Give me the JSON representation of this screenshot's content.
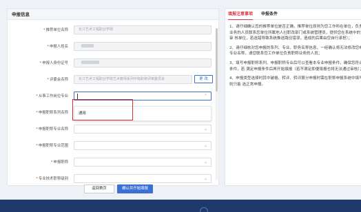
{
  "left_panel": {
    "title": "申报信息"
  },
  "form": {
    "recommender_unit": {
      "label": "推荐单位名称",
      "value": "长江艺术工程职业学院"
    },
    "applicant_name": {
      "label": "申报人姓名"
    },
    "applicant_id": {
      "label": "申报人身份证号"
    },
    "review_committee": {
      "label": "评委会名称",
      "value": "长江艺术工程职业学院艺术教师系列中级职称评审委员会",
      "change_label": "更 改"
    },
    "work_post": {
      "label": "从事工作岗位专业"
    },
    "title_series": {
      "label": "申报职称系列名称"
    },
    "title_specialty": {
      "label": "申报职称专业名称"
    },
    "title_scope": {
      "label": "申报职称专业范围"
    },
    "title_level": {
      "label": "申报职称"
    },
    "prof_title": {
      "label": "专业技术职称级别"
    }
  },
  "dropdown": {
    "options": [
      "通用"
    ]
  },
  "buttons": {
    "back": "返回首页",
    "confirm": "确认并开始填报"
  },
  "right_panel": {
    "tabs": [
      "填报注意事项",
      "申报条件"
    ],
    "notes": [
      "1、请仔细确认您的推荐单位是否正确，推荐单位原则为您工作所在单位，负责 职称业务的人员联系您单位所属地人社职改部门或系统管理员，提供您在系统中的第一级审 核单位，若选错导致系统推送路径错误，造成的后果由您自行承担）；",
      "2、请仔细核对您申报的系列、专业、职务名称信息，一经确认将无法修改您申报的 专业名称，请您联系您工作单位负责职称业务的人员；",
      "3、填写申报职称系列、申报职称专业后可以查看本专业申报条件，确保您符合 申报条件，若 满足申报条件后再开始填报（若不满足即便填报也将无法通过审核）；",
      "4、申报类型选择时其中破格、转评、转评算分申报时需在职称申报系统中填写，否 则只能 选正常申报。"
    ]
  },
  "colors": {
    "accent": "#3b6fd4",
    "highlight": "#e02d2d",
    "tab_active": "#d9363e",
    "footer": "#1d3a6b"
  }
}
